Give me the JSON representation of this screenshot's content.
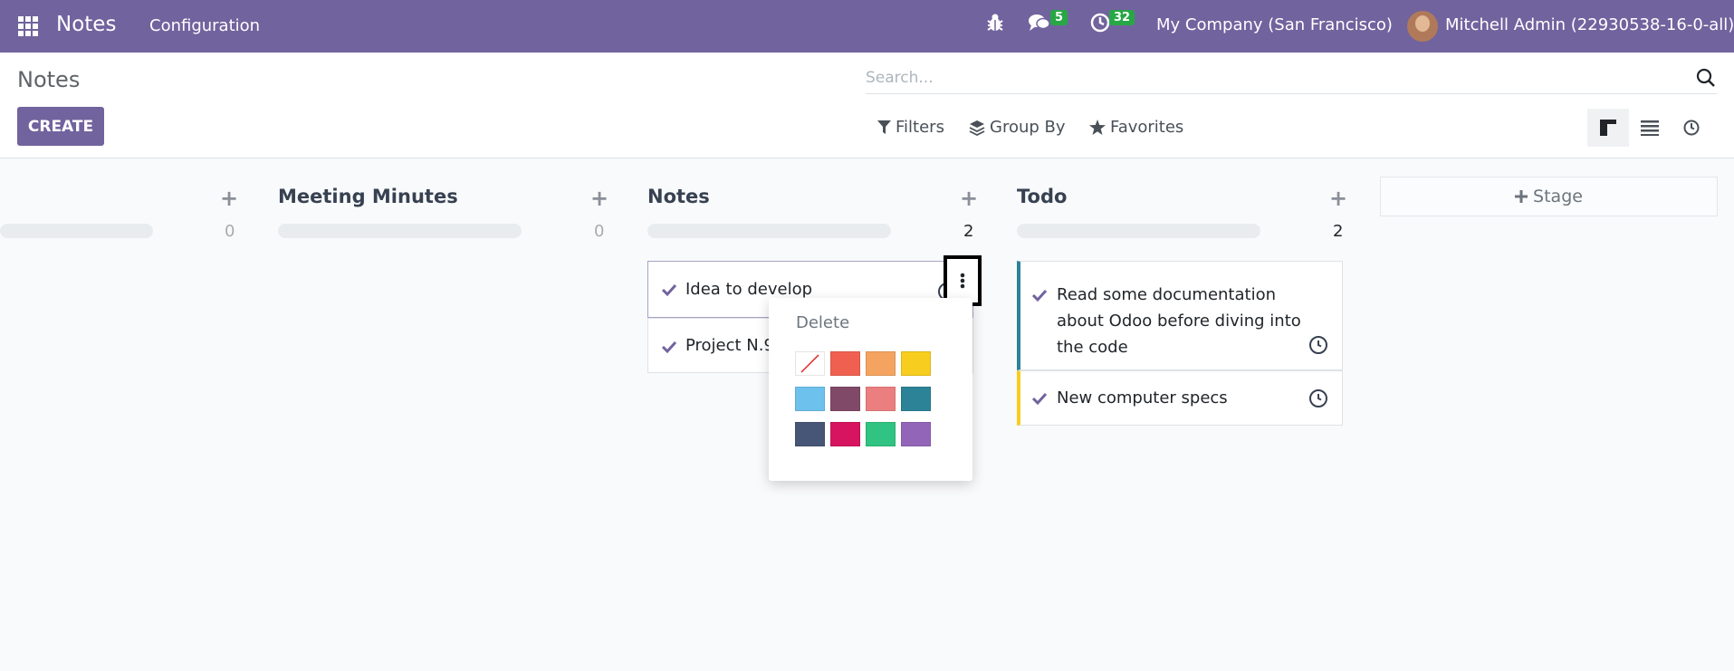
{
  "navbar": {
    "app_name": "Notes",
    "menu_configuration": "Configuration",
    "messages_count": "5",
    "activities_count": "32",
    "company": "My Company (San Francisco)",
    "user": "Mitchell Admin (22930538-16-0-all)"
  },
  "control_panel": {
    "breadcrumb": "Notes",
    "create_label": "CREATE",
    "search_placeholder": "Search...",
    "filters_label": "Filters",
    "group_by_label": "Group By",
    "favorites_label": "Favorites"
  },
  "columns": [
    {
      "title": "",
      "count": "0"
    },
    {
      "title": "Meeting Minutes",
      "count": "0"
    },
    {
      "title": "Notes",
      "count": "2",
      "cards": [
        {
          "text": "Idea to develop"
        },
        {
          "text": "Project N.9"
        }
      ]
    },
    {
      "title": "Todo",
      "count": "2",
      "cards": [
        {
          "line1": "Read some documentation",
          "line2": "about Odoo before diving into",
          "line3": "the code",
          "color": "#2c8397"
        },
        {
          "line1": "New computer specs",
          "color": "#f7cd1f"
        }
      ]
    }
  ],
  "add_stage_label": "Stage",
  "dropdown": {
    "delete_label": "Delete",
    "colors": [
      "none",
      "#f06050",
      "#f4a460",
      "#f7cd1f",
      "#6cc1ed",
      "#814968",
      "#eb7e7f",
      "#2c8397",
      "#475577",
      "#d6145f",
      "#30c381",
      "#9365b8"
    ]
  }
}
